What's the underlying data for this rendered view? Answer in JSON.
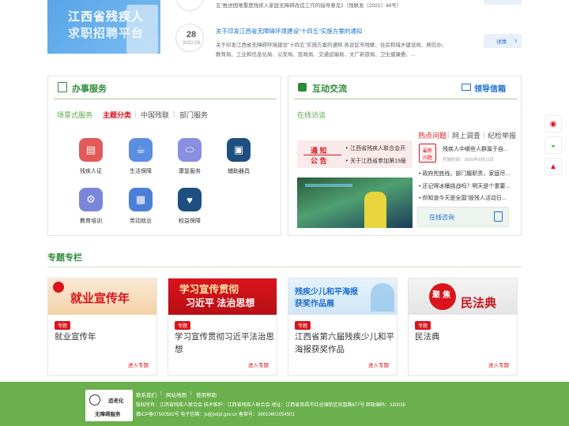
{
  "banner": {
    "line1": "江西省残疾人",
    "line2": "求职招聘平台"
  },
  "news": {
    "top_desc": "五\"推进困难重度残疾人家庭无障碍改造工作的指导意见》（残联发〔2021〕48号）",
    "day": "28",
    "date": "2022-09",
    "title": "关于印发江西省无障碍环境建设\"十四五\"实施方案的通知",
    "desc1": "关于印发江西省无障碍环境建设\"十四五\"实施方案的通知 各设区市残联、住房和城乡建设局、网信办、",
    "desc2": "教育局、工业和信息化局、公安局、民政局、交通运输局、文广新旅局、卫生健康委、...",
    "detail_label": "详情"
  },
  "affairs": {
    "title": "办事服务",
    "tabs": [
      "场景式服务",
      "主题分类",
      "中国残联",
      "部门服务"
    ],
    "services": [
      {
        "label": "残疾人证",
        "icon": "id-card-icon",
        "color": "#e05a5a"
      },
      {
        "label": "生活保障",
        "icon": "coffee-cup-icon",
        "color": "#5b8de0"
      },
      {
        "label": "康复服务",
        "icon": "pill-icon",
        "color": "#8a8fe0"
      },
      {
        "label": "辅助器具",
        "icon": "monitor-icon",
        "color": "#1f4f80"
      },
      {
        "label": "教育培训",
        "icon": "gear-icon",
        "color": "#7a86d8"
      },
      {
        "label": "劳动就业",
        "icon": "briefcase-icon",
        "color": "#4c7fd8"
      },
      {
        "label": "权益保障",
        "icon": "hands-icon",
        "color": "#1f4f80"
      }
    ]
  },
  "interaction": {
    "title": "互动交流",
    "mail_label": "领导信箱",
    "online_label": "在线访谈",
    "hot_tabs": [
      "热点问题",
      "网上调查",
      "纪检举报"
    ],
    "notice_label1": "通 知",
    "notice_label2": "公 告",
    "notices": [
      "江西省残疾人联合会开",
      "关于江西省参加第19届"
    ],
    "latest_badge1": "最新",
    "latest_badge2": "问题",
    "latest_title": "残疾人中哪些人群属于自...",
    "latest_date": "开始时间：2020年8月11日",
    "hot_list": [
      "政府兜底线，部门履职责，家庭尽...",
      "还记得冰桶挑战吗？明天是个重要...",
      "你知道今天是全国\"肢残人活动日..."
    ],
    "consult_label": "在线咨询"
  },
  "topics": {
    "title": "专题专栏",
    "items": [
      {
        "badge": "专题",
        "title": "就业宣传年",
        "img_text": "就业宣传年",
        "enter": "进入专题"
      },
      {
        "badge": "专题",
        "title": "学习宣传贯彻习近平法治思想",
        "img_text1": "学习宣传贯彻",
        "img_text2": "习近平 法治思想",
        "enter": "进入专题"
      },
      {
        "badge": "专题",
        "title": "江西省第六届残疾少儿和平海报获奖作品",
        "img_text1": "残疾少儿和平海报",
        "img_text2": "获奖作品展",
        "enter": "进入专题"
      },
      {
        "badge": "专题",
        "title": "民法典",
        "img_text1": "聚焦",
        "img_text2": "民法典",
        "enter": "进入专题"
      }
    ]
  },
  "footer": {
    "logo_line1": "适老化",
    "logo_line2": "无障碍服务",
    "links": [
      "联系我们",
      "网站地图",
      "使用帮助"
    ],
    "info1": "版权所有：江西省残疾人联合会 技术维护：江西省残疾人联合会 地址：江西省南昌市红谷滩新区凤凰路877号 邮政编码：330038",
    "info2": "赣ICP备07500582号 电子信箱：jx@jxdpf.gov.cn 备案号：36010601054501"
  },
  "side": [
    "weibo-icon",
    "wechat-icon",
    "toutiao-icon"
  ]
}
